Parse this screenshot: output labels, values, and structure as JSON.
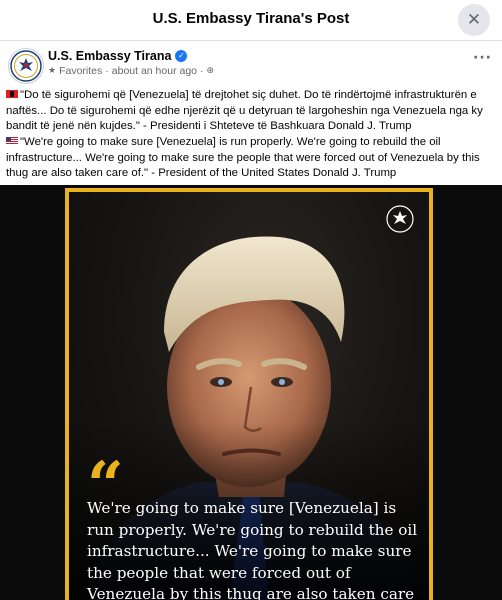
{
  "dialog": {
    "title": "U.S. Embassy Tirana's Post",
    "close_icon": "close-icon",
    "close_glyph": "✕"
  },
  "post": {
    "page_name": "U.S. Embassy Tirana",
    "verified_icon": "verified-badge-icon",
    "favorites_label": "Favorites",
    "separator": "·",
    "time": "about an hour ago",
    "audience_icon": "globe-icon",
    "more_icon": "more-options-icon",
    "paragraph_albanian": "\"Do të sigurohemi që [Venezuela] të drejtohet siç duhet. Do të rindërtojmë infrastrukturën e naftës... Do të sigurohemi që edhe njerëzit që u detyruan të largoheshin nga Venezuela nga ky bandit të jenë nën kujdes.\" - Presidenti i Shteteve të Bashkuara Donald J. Trump",
    "paragraph_english": "\"We're going to make sure [Venezuela] is run properly. We're going to rebuild the oil infrastructure... We're going to make sure the people that were forced out of Venezuela by this thug are also taken care of.\" - President of the United States Donald J. Trump",
    "flag_albanian": "albania-flag-icon",
    "flag_english": "us-flag-icon"
  },
  "image": {
    "quote_mark": "“",
    "quote_text": "We're going to make sure [Venezuela] is run properly. We're going to rebuild the oil infrastructure... We're going to make sure the people that were forced out of Venezuela by this thug are also taken care of.",
    "seal_icon": "embassy-seal-icon",
    "frame_color": "#e9b31b"
  },
  "colors": {
    "accent": "#1877f2",
    "meta_text": "#65676b",
    "frame": "#e9b31b"
  }
}
